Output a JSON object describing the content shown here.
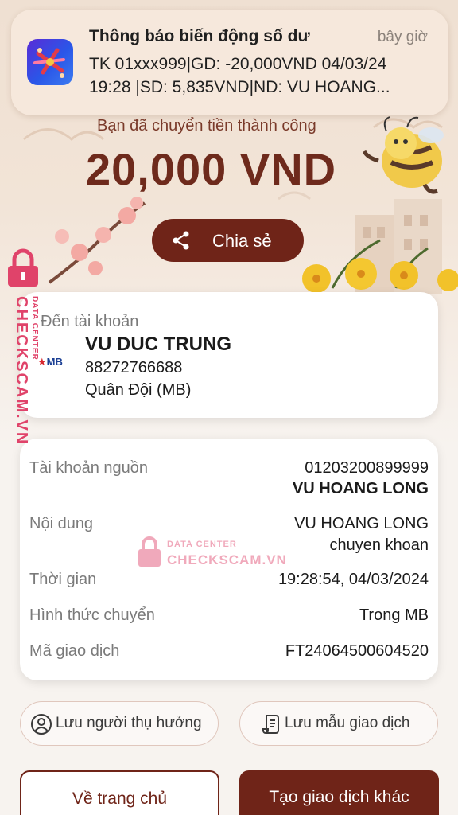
{
  "notification": {
    "title": "Thông báo biến động số dư",
    "time": "bây giờ",
    "line1": "TK 01xxx999|GD: -20,000VND 04/03/24",
    "line2": "19:28 |SD: 5,835VND|ND: VU HOANG..."
  },
  "hero": {
    "success_message": "Bạn đã chuyển tiền thành công",
    "amount": "20,000 VND",
    "share_label": "Chia sẻ"
  },
  "recipient": {
    "label": "Đến tài khoản",
    "bank_logo": "MB",
    "name": "VU DUC TRUNG",
    "account": "88272766688",
    "bank": "Quân Đội (MB)"
  },
  "details": {
    "source_label": "Tài khoản nguồn",
    "source_account": "01203200899999",
    "source_name": "VU HOANG LONG",
    "content_label": "Nội dung",
    "content_line1": "VU HOANG LONG",
    "content_line2": "chuyen khoan",
    "time_label": "Thời gian",
    "time_value": "19:28:54, 04/03/2024",
    "method_label": "Hình thức chuyển",
    "method_value": "Trong MB",
    "txn_label": "Mã giao dịch",
    "txn_value": "FT24064500604520"
  },
  "actions": {
    "save_beneficiary": "Lưu người thụ hưởng",
    "save_template": "Lưu mẫu giao dịch",
    "home": "Về trang chủ",
    "new_transaction": "Tạo giao dịch khác"
  },
  "watermark": {
    "side_main": "CHECKSCAM.VN",
    "side_small": "DATA CENTER",
    "center_top": "DATA CENTER",
    "center_main": "CHECKSCAM.VN"
  },
  "colors": {
    "brand": "#6f2418",
    "watermark": "#e0436a"
  }
}
